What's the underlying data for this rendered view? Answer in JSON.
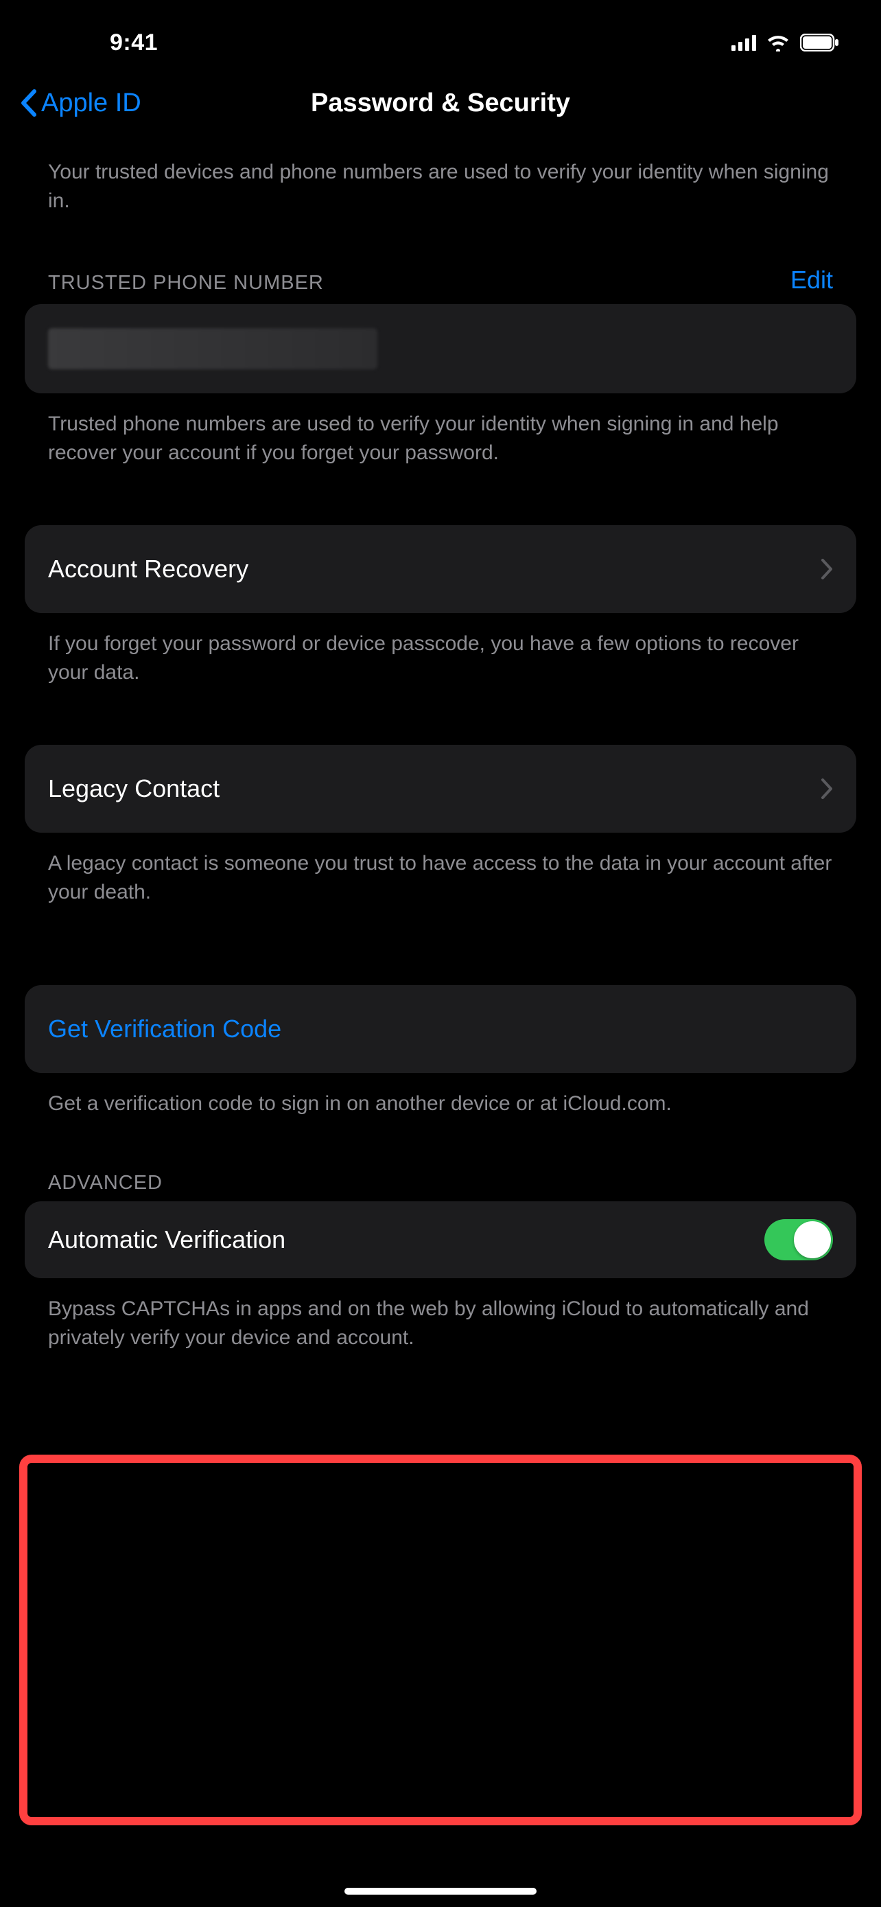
{
  "status": {
    "time": "9:41"
  },
  "nav": {
    "back_label": "Apple ID",
    "title": "Password & Security"
  },
  "intro_footer": "Your trusted devices and phone numbers are used to verify your identity when signing in.",
  "trusted_phone": {
    "header": "TRUSTED PHONE NUMBER",
    "edit_label": "Edit",
    "footer": "Trusted phone numbers are used to verify your identity when signing in and help recover your account if you forget your password."
  },
  "account_recovery": {
    "label": "Account Recovery",
    "footer": "If you forget your password or device passcode, you have a few options to recover your data."
  },
  "legacy_contact": {
    "label": "Legacy Contact",
    "footer": "A legacy contact is someone you trust to have access to the data in your account after your death."
  },
  "verification_code": {
    "label": "Get Verification Code",
    "footer": "Get a verification code to sign in on another device or at iCloud.com."
  },
  "advanced": {
    "header": "ADVANCED",
    "automatic_verification_label": "Automatic Verification",
    "automatic_verification_on": true,
    "footer": "Bypass CAPTCHAs in apps and on the web by allowing iCloud to automatically and privately verify your device and account."
  }
}
